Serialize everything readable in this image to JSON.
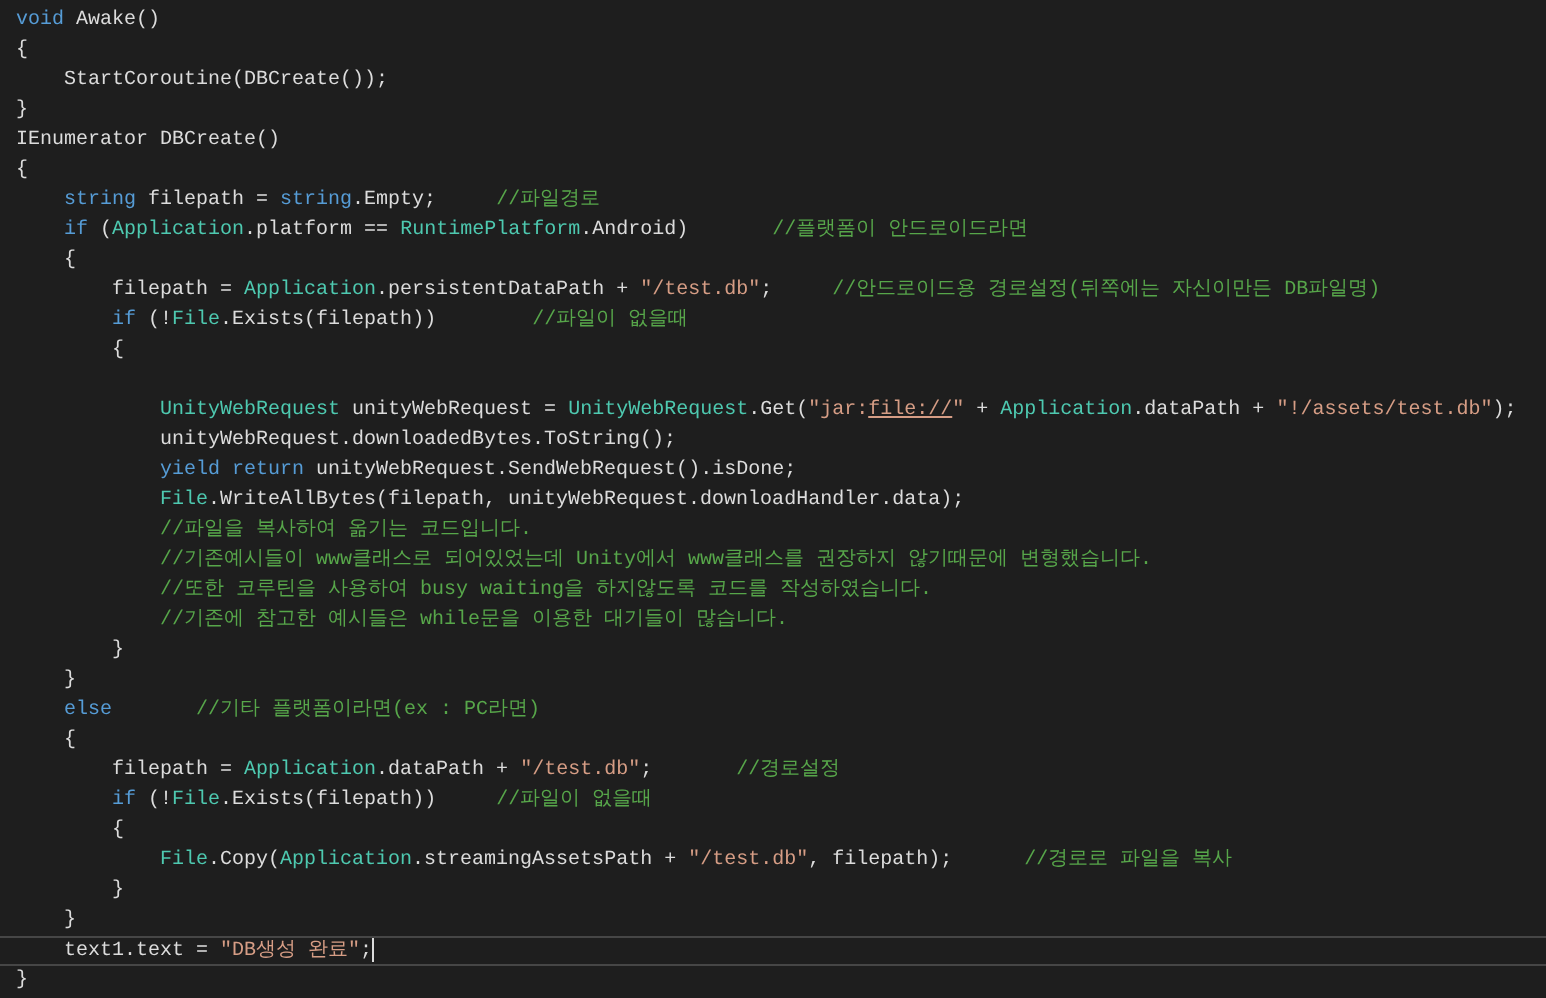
{
  "editor": {
    "lines": [
      {
        "current": false,
        "tokens": [
          {
            "kind": "keyword",
            "text": "void"
          },
          {
            "kind": "plain",
            "text": " Awake()"
          }
        ]
      },
      {
        "current": false,
        "tokens": [
          {
            "kind": "plain",
            "text": "{"
          }
        ]
      },
      {
        "current": false,
        "tokens": [
          {
            "kind": "plain",
            "text": "    StartCoroutine(DBCreate());"
          }
        ]
      },
      {
        "current": false,
        "tokens": [
          {
            "kind": "plain",
            "text": "}"
          }
        ]
      },
      {
        "current": false,
        "tokens": [
          {
            "kind": "plain",
            "text": "IEnumerator DBCreate()"
          }
        ]
      },
      {
        "current": false,
        "tokens": [
          {
            "kind": "plain",
            "text": "{"
          }
        ]
      },
      {
        "current": false,
        "tokens": [
          {
            "kind": "keyword",
            "text": "    string"
          },
          {
            "kind": "plain",
            "text": " filepath = "
          },
          {
            "kind": "keyword",
            "text": "string"
          },
          {
            "kind": "plain",
            "text": ".Empty;     "
          },
          {
            "kind": "comment",
            "text": "//파일경로"
          }
        ]
      },
      {
        "current": false,
        "tokens": [
          {
            "kind": "keyword",
            "text": "    if"
          },
          {
            "kind": "plain",
            "text": " ("
          },
          {
            "kind": "type",
            "text": "Application"
          },
          {
            "kind": "plain",
            "text": ".platform == "
          },
          {
            "kind": "type",
            "text": "RuntimePlatform"
          },
          {
            "kind": "plain",
            "text": ".Android)       "
          },
          {
            "kind": "comment",
            "text": "//플랫폼이 안드로이드라면"
          }
        ]
      },
      {
        "current": false,
        "tokens": [
          {
            "kind": "plain",
            "text": "    {"
          }
        ]
      },
      {
        "current": false,
        "tokens": [
          {
            "kind": "plain",
            "text": "        filepath = "
          },
          {
            "kind": "type",
            "text": "Application"
          },
          {
            "kind": "plain",
            "text": ".persistentDataPath + "
          },
          {
            "kind": "string",
            "text": "\"/test.db\""
          },
          {
            "kind": "plain",
            "text": ";     "
          },
          {
            "kind": "comment",
            "text": "//안드로이드용 경로설정(뒤쪽에는 자신이만든 DB파일명)"
          }
        ]
      },
      {
        "current": false,
        "tokens": [
          {
            "kind": "keyword",
            "text": "        if"
          },
          {
            "kind": "plain",
            "text": " (!"
          },
          {
            "kind": "type",
            "text": "File"
          },
          {
            "kind": "plain",
            "text": ".Exists(filepath))        "
          },
          {
            "kind": "comment",
            "text": "//파일이 없을때"
          }
        ]
      },
      {
        "current": false,
        "tokens": [
          {
            "kind": "plain",
            "text": "        {"
          }
        ]
      },
      {
        "current": false
      },
      {
        "current": false,
        "tokens": [
          {
            "kind": "type",
            "text": "            UnityWebRequest"
          },
          {
            "kind": "plain",
            "text": " unityWebRequest = "
          },
          {
            "kind": "type",
            "text": "UnityWebRequest"
          },
          {
            "kind": "plain",
            "text": ".Get("
          },
          {
            "kind": "string",
            "text": "\"jar:"
          },
          {
            "kind": "link",
            "text": "file://"
          },
          {
            "kind": "string",
            "text": "\""
          },
          {
            "kind": "plain",
            "text": " + "
          },
          {
            "kind": "type",
            "text": "Application"
          },
          {
            "kind": "plain",
            "text": ".dataPath + "
          },
          {
            "kind": "string",
            "text": "\"!/assets/test.db\""
          },
          {
            "kind": "plain",
            "text": ");"
          }
        ]
      },
      {
        "current": false,
        "tokens": [
          {
            "kind": "plain",
            "text": "            unityWebRequest.downloadedBytes.ToString();"
          }
        ]
      },
      {
        "current": false,
        "tokens": [
          {
            "kind": "keyword",
            "text": "            yield return"
          },
          {
            "kind": "plain",
            "text": " unityWebRequest.SendWebRequest().isDone;"
          }
        ]
      },
      {
        "current": false,
        "tokens": [
          {
            "kind": "type",
            "text": "            File"
          },
          {
            "kind": "plain",
            "text": ".WriteAllBytes(filepath, unityWebRequest.downloadHandler.data);"
          }
        ]
      },
      {
        "current": false,
        "tokens": [
          {
            "kind": "comment",
            "text": "            //파일을 복사하여 옮기는 코드입니다."
          }
        ]
      },
      {
        "current": false,
        "tokens": [
          {
            "kind": "comment",
            "text": "            //기존예시들이 www클래스로 되어있었는데 Unity에서 www클래스를 권장하지 않기때문에 변형했습니다."
          }
        ]
      },
      {
        "current": false,
        "tokens": [
          {
            "kind": "comment",
            "text": "            //또한 코루틴을 사용하여 busy waiting을 하지않도록 코드를 작성하였습니다."
          }
        ]
      },
      {
        "current": false,
        "tokens": [
          {
            "kind": "comment",
            "text": "            //기존에 참고한 예시들은 while문을 이용한 대기들이 많습니다."
          }
        ]
      },
      {
        "current": false,
        "tokens": [
          {
            "kind": "plain",
            "text": "        }"
          }
        ]
      },
      {
        "current": false,
        "tokens": [
          {
            "kind": "plain",
            "text": "    }"
          }
        ]
      },
      {
        "current": false,
        "tokens": [
          {
            "kind": "keyword",
            "text": "    else"
          },
          {
            "kind": "comment",
            "text": "       //기타 플랫폼이라면(ex : PC라면)"
          }
        ]
      },
      {
        "current": false,
        "tokens": [
          {
            "kind": "plain",
            "text": "    {"
          }
        ]
      },
      {
        "current": false,
        "tokens": [
          {
            "kind": "plain",
            "text": "        filepath = "
          },
          {
            "kind": "type",
            "text": "Application"
          },
          {
            "kind": "plain",
            "text": ".dataPath + "
          },
          {
            "kind": "string",
            "text": "\"/test.db\""
          },
          {
            "kind": "plain",
            "text": ";       "
          },
          {
            "kind": "comment",
            "text": "//경로설정"
          }
        ]
      },
      {
        "current": false,
        "tokens": [
          {
            "kind": "keyword",
            "text": "        if"
          },
          {
            "kind": "plain",
            "text": " (!"
          },
          {
            "kind": "type",
            "text": "File"
          },
          {
            "kind": "plain",
            "text": ".Exists(filepath))     "
          },
          {
            "kind": "comment",
            "text": "//파일이 없을때"
          }
        ]
      },
      {
        "current": false,
        "tokens": [
          {
            "kind": "plain",
            "text": "        {"
          }
        ]
      },
      {
        "current": false,
        "tokens": [
          {
            "kind": "type",
            "text": "            File"
          },
          {
            "kind": "plain",
            "text": ".Copy("
          },
          {
            "kind": "type",
            "text": "Application"
          },
          {
            "kind": "plain",
            "text": ".streamingAssetsPath + "
          },
          {
            "kind": "string",
            "text": "\"/test.db\""
          },
          {
            "kind": "plain",
            "text": ", filepath);      "
          },
          {
            "kind": "comment",
            "text": "//경로로 파일을 복사"
          }
        ]
      },
      {
        "current": false,
        "tokens": [
          {
            "kind": "plain",
            "text": "        }"
          }
        ]
      },
      {
        "current": false,
        "tokens": [
          {
            "kind": "plain",
            "text": "    }"
          }
        ]
      },
      {
        "current": true,
        "tokens": [
          {
            "kind": "plain",
            "text": "    text1.text = "
          },
          {
            "kind": "string",
            "text": "\"DB생성 완료\""
          },
          {
            "kind": "plain",
            "text": ";"
          }
        ]
      },
      {
        "current": false,
        "tokens": [
          {
            "kind": "plain",
            "text": "}"
          }
        ]
      }
    ]
  }
}
